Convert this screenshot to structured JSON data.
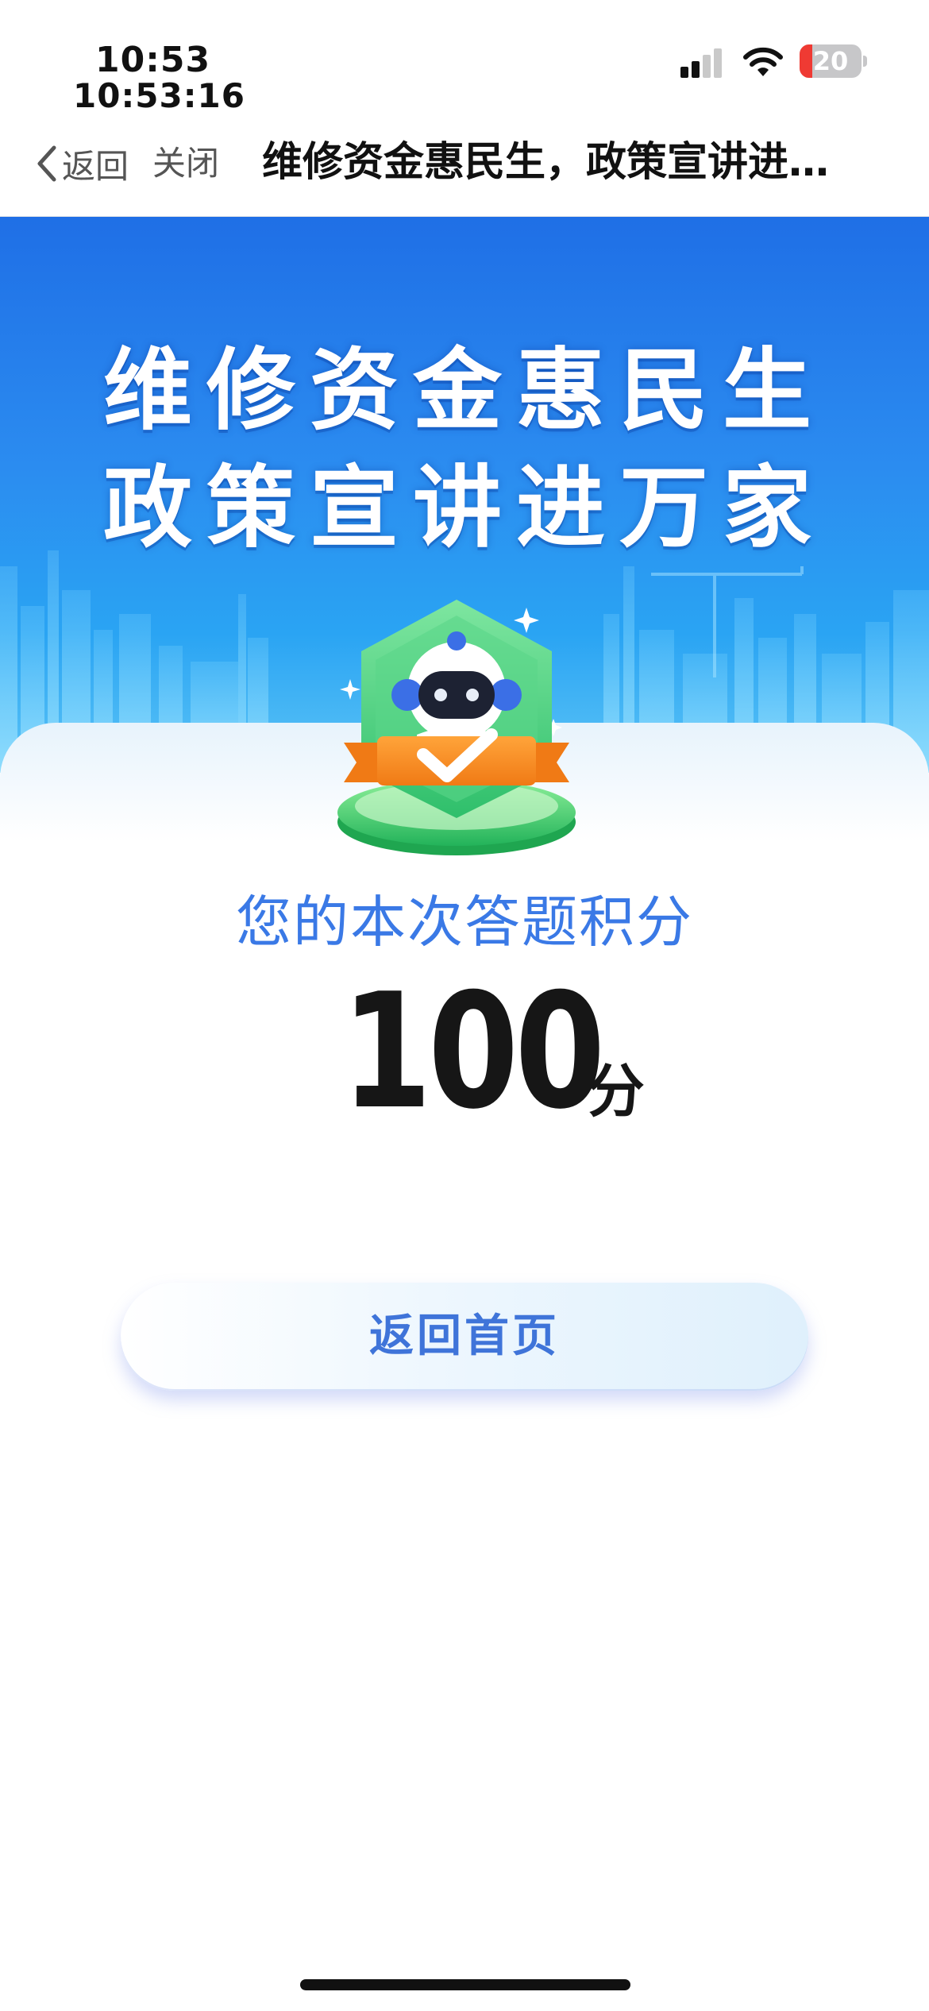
{
  "status_bar": {
    "time": "10:53",
    "time_seconds": "10:53:16",
    "battery_level": "20",
    "battery_color": "#ef3a33",
    "signal_icon": "signal-bars-icon",
    "wifi_icon": "wifi-icon"
  },
  "nav": {
    "back_label": "返回",
    "close_label": "关闭",
    "title": "维修资金惠民生，政策宣讲进…"
  },
  "banner": {
    "title_line1": "维修资金惠民生",
    "title_line2": "政策宣讲进万家",
    "background_color": "#2b8cf0"
  },
  "result": {
    "label": "您的本次答题积分",
    "score": "100",
    "unit": "分",
    "badge_icon": "robot-check-badge-icon",
    "label_color": "#3a79e6"
  },
  "actions": {
    "home_button_label": "返回首页",
    "button_text_color": "#3f74d9"
  }
}
